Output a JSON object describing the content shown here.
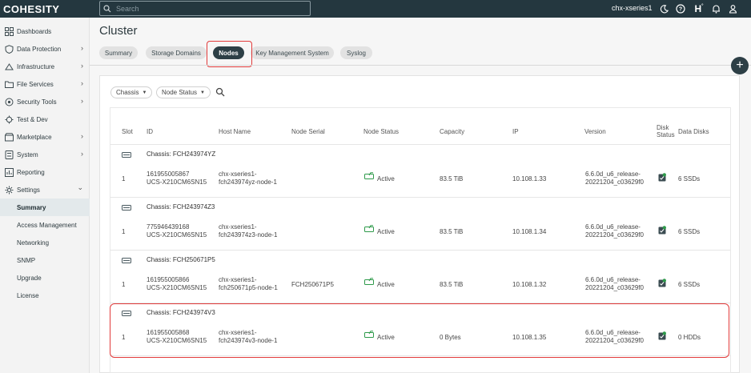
{
  "brand": {
    "logo_text": "COHESITY"
  },
  "topbar": {
    "search_placeholder": "Search",
    "cluster_name": "chx-xseries1",
    "icons": [
      "moon-icon",
      "help-icon",
      "health-icon",
      "bell-icon",
      "user-icon"
    ],
    "health_letter": "H"
  },
  "sidebar": {
    "items": [
      {
        "label": "Dashboards",
        "icon": "dashboard-icon",
        "has_children": false
      },
      {
        "label": "Data Protection",
        "icon": "shield-icon",
        "has_children": true
      },
      {
        "label": "Infrastructure",
        "icon": "infrastructure-icon",
        "has_children": true
      },
      {
        "label": "File Services",
        "icon": "folder-icon",
        "has_children": true
      },
      {
        "label": "Security Tools",
        "icon": "security-icon",
        "has_children": true
      },
      {
        "label": "Test & Dev",
        "icon": "test-dev-icon",
        "has_children": false
      },
      {
        "label": "Marketplace",
        "icon": "marketplace-icon",
        "has_children": true
      },
      {
        "label": "System",
        "icon": "system-icon",
        "has_children": true
      },
      {
        "label": "Reporting",
        "icon": "reporting-icon",
        "has_children": false
      },
      {
        "label": "Settings",
        "icon": "gear-icon",
        "has_children": true,
        "expanded": true
      }
    ],
    "settings_children": [
      "Summary",
      "Access Management",
      "Networking",
      "SNMP",
      "Upgrade",
      "License"
    ],
    "active_child": "Summary"
  },
  "page": {
    "title": "Cluster",
    "tabs": [
      "Summary",
      "Storage Domains",
      "Nodes",
      "Key Management System",
      "Syslog"
    ],
    "active_tab": "Nodes",
    "fab_label": "+"
  },
  "filters": {
    "chassis": "Chassis",
    "node_status": "Node Status"
  },
  "table": {
    "columns": [
      "Slot",
      "ID",
      "Host Name",
      "Node Serial",
      "Node Status",
      "Capacity",
      "IP",
      "Version",
      "Disk Status",
      "Data Disks"
    ],
    "groups": [
      {
        "chassis": "Chassis: FCH243974YZ",
        "slot": "1",
        "id_line1": "161955005867",
        "id_line2": "UCS-X210CM6SN15",
        "host_line1": "chx-xseries1-",
        "host_line2": "fch243974yz-node-1",
        "serial": "",
        "status": "Active",
        "capacity": "83.5 TiB",
        "ip": "10.108.1.33",
        "version_line1": "6.6.0d_u6_release-",
        "version_line2": "20221204_c03629f0",
        "data_disks": "6 SSDs"
      },
      {
        "chassis": "Chassis: FCH243974Z3",
        "slot": "1",
        "id_line1": "775946439168",
        "id_line2": "UCS-X210CM6SN15",
        "host_line1": "chx-xseries1-",
        "host_line2": "fch243974z3-node-1",
        "serial": "",
        "status": "Active",
        "capacity": "83.5 TiB",
        "ip": "10.108.1.34",
        "version_line1": "6.6.0d_u6_release-",
        "version_line2": "20221204_c03629f0",
        "data_disks": "6 SSDs"
      },
      {
        "chassis": "Chassis: FCH250671P5",
        "slot": "1",
        "id_line1": "161955005866",
        "id_line2": "UCS-X210CM6SN15",
        "host_line1": "chx-xseries1-",
        "host_line2": "fch250671p5-node-1",
        "serial": "FCH250671P5",
        "status": "Active",
        "capacity": "83.5 TiB",
        "ip": "10.108.1.32",
        "version_line1": "6.6.0d_u6_release-",
        "version_line2": "20221204_c03629f0",
        "data_disks": "6 SSDs"
      },
      {
        "chassis": "Chassis: FCH243974V3",
        "slot": "1",
        "id_line1": "161955005868",
        "id_line2": "UCS-X210CM6SN15",
        "host_line1": "chx-xseries1-",
        "host_line2": "fch243974v3-node-1",
        "serial": "",
        "status": "Active",
        "capacity": "0 Bytes",
        "ip": "10.108.1.35",
        "version_line1": "6.6.0d_u6_release-",
        "version_line2": "20221204_c03629f0",
        "data_disks": "0 HDDs"
      }
    ]
  },
  "colors": {
    "topbar": "#24373f",
    "active_tab": "#2d3f46",
    "status_green": "#2e9a4a",
    "highlight_red": "#e23b3b"
  }
}
